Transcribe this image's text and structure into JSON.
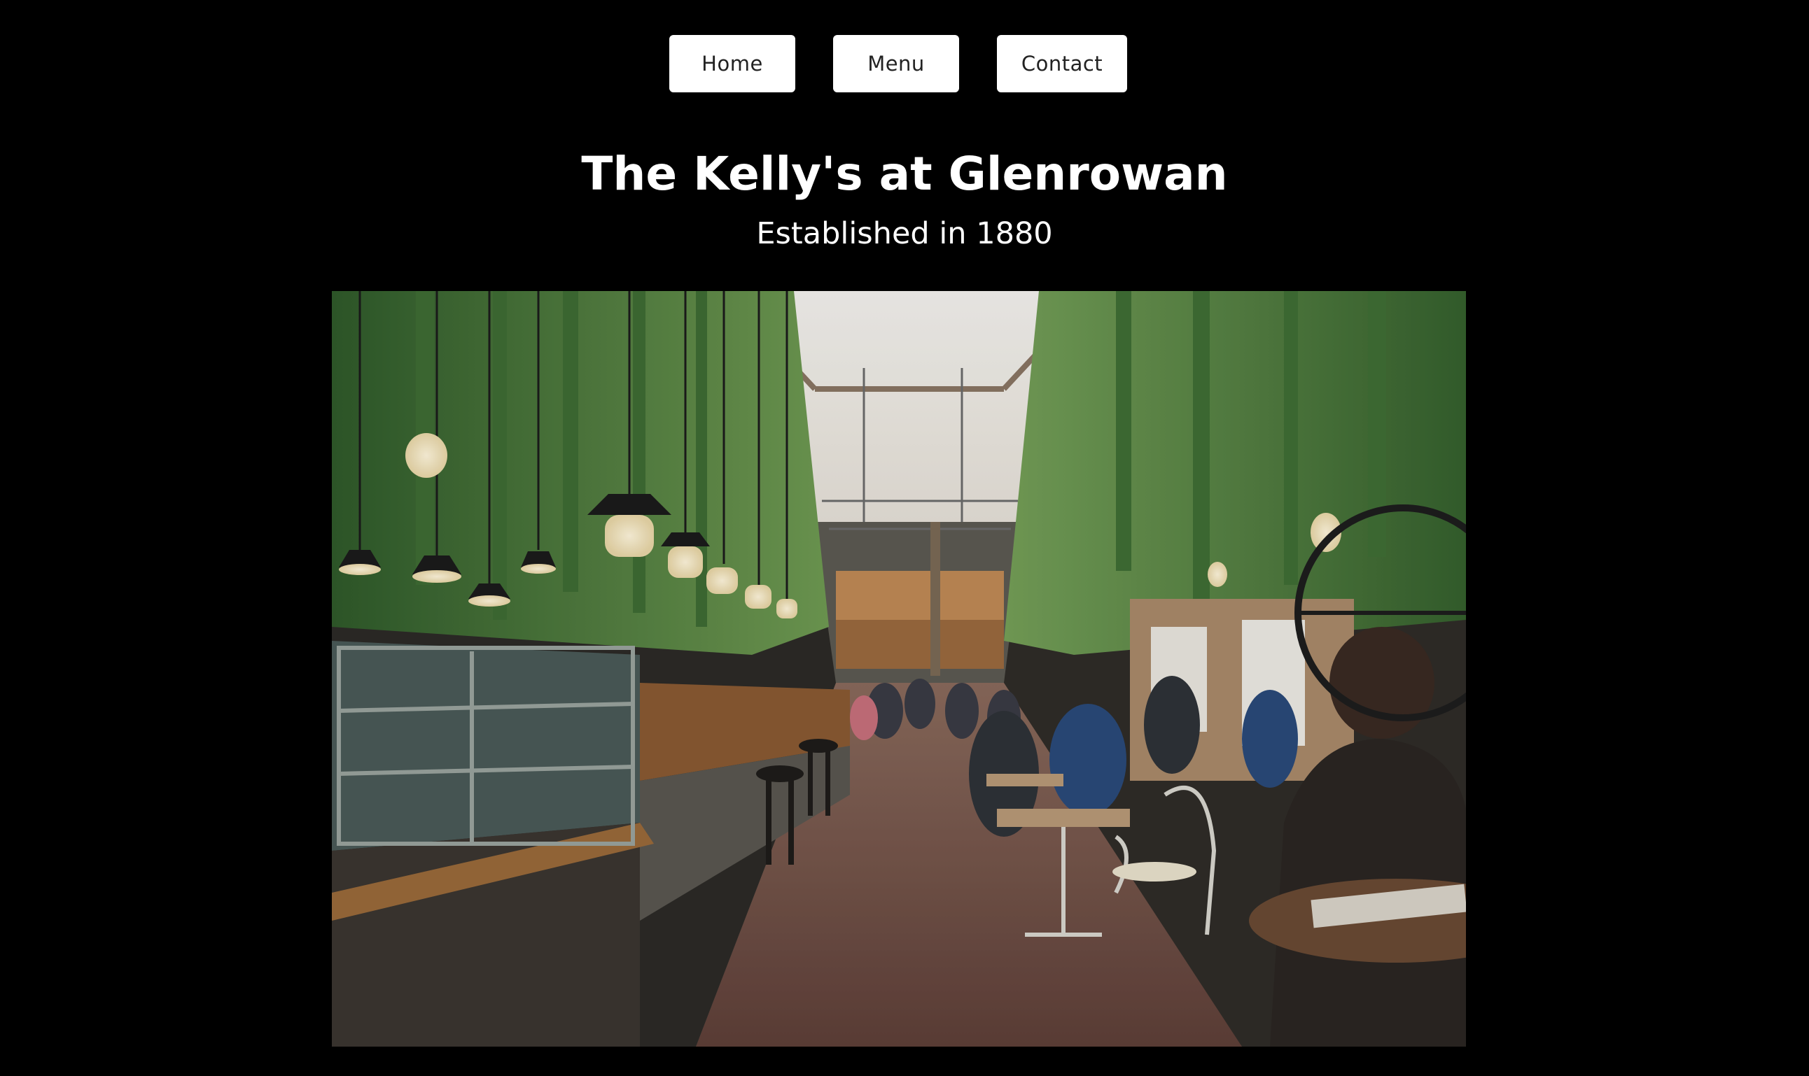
{
  "nav": {
    "items": [
      {
        "label": "Home"
      },
      {
        "label": "Menu"
      },
      {
        "label": "Contact"
      }
    ]
  },
  "header": {
    "title": "The Kelly's at Glenrowan",
    "subtitle": "Established in 1880"
  },
  "colors": {
    "background": "#000000",
    "nav_button_bg": "#ffffff",
    "nav_button_text": "#222222",
    "heading_text": "#ffffff"
  }
}
